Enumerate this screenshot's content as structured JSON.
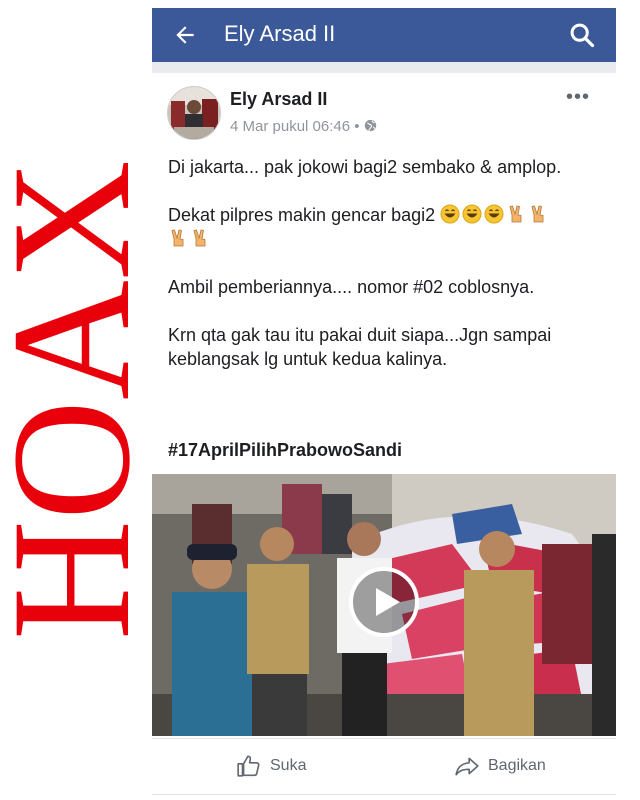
{
  "overlay": {
    "text": "HOAX",
    "color": "#e8000b"
  },
  "appbar": {
    "title": "Ely Arsad II",
    "color": "#3b5998"
  },
  "post": {
    "author": "Ely Arsad II",
    "timestamp": "4 Mar pukul 06:46",
    "privacy_icon": "globe-icon",
    "lines": {
      "l1": "Di jakarta... pak jokowi bagi2 sembako & amplop.",
      "l2": "Dekat pilpres makin gencar bagi2",
      "l3": "Ambil pemberiannya.... nomor #02 coblosnya.",
      "l4": "Krn qta gak tau itu pakai duit siapa...Jgn sampai keblangsak lg untuk kedua kalinya."
    },
    "emoji": [
      "grinning-sweat-emoji",
      "grinning-sweat-emoji",
      "grinning-sweat-emoji",
      "victory-hand-emoji",
      "victory-hand-emoji",
      "victory-hand-emoji",
      "victory-hand-emoji"
    ],
    "hashtag": "#17AprilPilihPrabowoSandi"
  },
  "actions": {
    "like": "Suka",
    "share": "Bagikan"
  }
}
